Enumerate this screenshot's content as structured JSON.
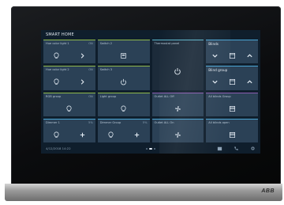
{
  "screen": {
    "title": "SMART HOME"
  },
  "brand": "ABB",
  "tiles": [
    {
      "label": "Hue color light 1",
      "value": "ON"
    },
    {
      "label": "Switch 2",
      "value": ""
    },
    {
      "label": "Thermostat panel",
      "value": ""
    },
    {
      "label": "Blinds",
      "value": ""
    },
    {
      "label": "Hue color light 2",
      "value": "ON"
    },
    {
      "label": "Switch 3",
      "value": ""
    },
    {
      "label": "Blind group",
      "value": ""
    },
    {
      "label": "RGB group",
      "value": "ON"
    },
    {
      "label": "Light group",
      "value": ""
    },
    {
      "label": "Outlet ALL Off",
      "value": ""
    },
    {
      "label": "All blinds Group",
      "value": ""
    },
    {
      "label": "Dimmer 1",
      "value": "5%"
    },
    {
      "label": "Dimmer Group",
      "value": "5%"
    },
    {
      "label": "Outlet ALL On",
      "value": ""
    },
    {
      "label": "All blinds open",
      "value": ""
    }
  ],
  "status_bar": {
    "datetime": "4/12/2018  14:22"
  },
  "icons": {
    "bulb": "bulb-icon",
    "arrow": "chevron-right-icon",
    "switch": "switch-icon",
    "power": "power-icon",
    "down": "chevron-down-icon",
    "up": "chevron-up-icon",
    "window": "window-icon",
    "fan": "fan-icon",
    "plus": "plus-icon",
    "minus": "minus-icon"
  }
}
